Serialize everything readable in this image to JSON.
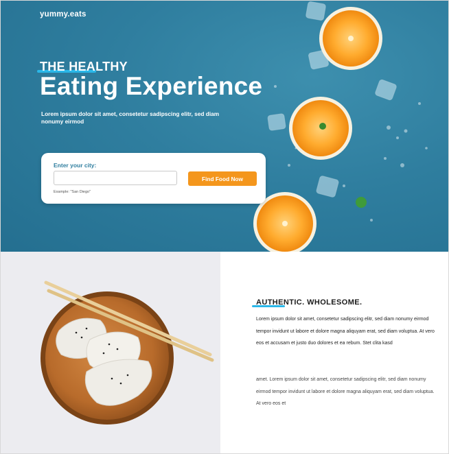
{
  "brand": {
    "logo": "yummy.eats"
  },
  "hero": {
    "eyebrow": "THE HEALTHY",
    "headline": "Eating Experience",
    "lead": "Lorem ipsum dolor sit amet, consetetur sadipscing elitr, sed diam nonumy eirmod"
  },
  "search": {
    "label": "Enter your city:",
    "value": "",
    "placeholder": "",
    "hint": "Example: \"San Diego\"",
    "button_label": "Find Food Now"
  },
  "about": {
    "title": "AUTHENTIC. WHOLESOME.",
    "paragraph1": "Lorem ipsum dolor sit amet, consetetur sadipscing elitr, sed diam nonumy eirmod tempor invidunt ut labore et dolore magna aliquyam erat, sed diam voluptua. At vero eos et accusam et justo duo dolores et ea rebum. Stet clita kasd",
    "paragraph2": "amet. Lorem ipsum dolor sit amet, consetetur sadipscing elitr, sed diam nonumy eirmod tempor invidunt ut labore et dolore magna aliquyam erat, sed diam voluptua. At vero eos et"
  },
  "colors": {
    "hero_blue": "#2f7e9f",
    "accent_orange": "#f4961c",
    "underline_blue": "#2ab7e8"
  },
  "images": {
    "hero": "orange-slices-ice-cubes-on-blue",
    "feature": "dumplings-on-wooden-plate-with-chopsticks"
  }
}
